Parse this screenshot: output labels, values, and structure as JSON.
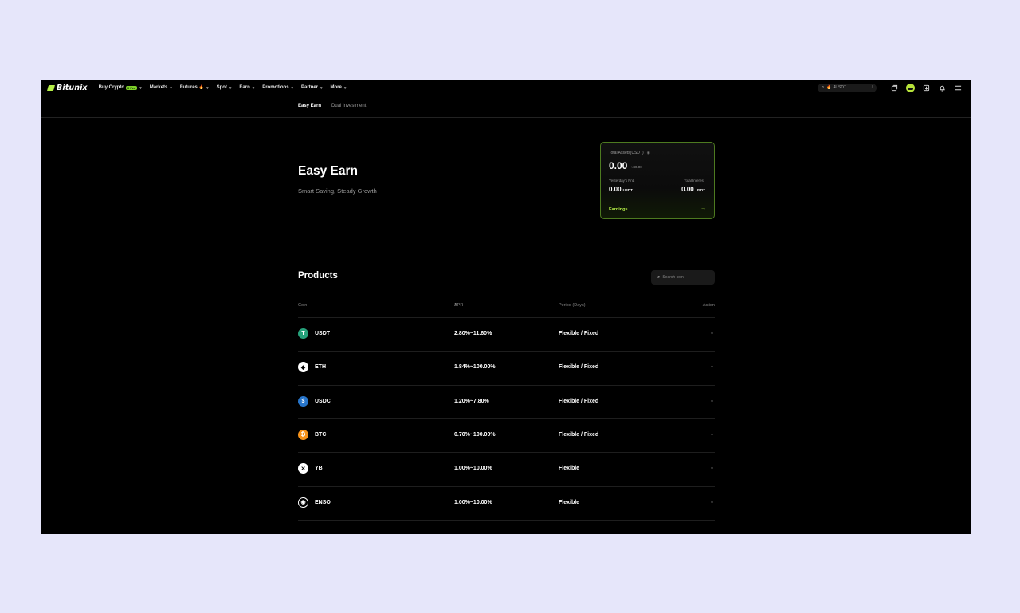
{
  "brand": {
    "name": "Bitunix"
  },
  "nav": {
    "items": [
      {
        "label": "Buy Crypto",
        "badge": "0 Fee"
      },
      {
        "label": "Markets"
      },
      {
        "label": "Futures",
        "flame": "🔥"
      },
      {
        "label": "Spot"
      },
      {
        "label": "Earn"
      },
      {
        "label": "Promotions"
      },
      {
        "label": "Partner"
      },
      {
        "label": "More"
      }
    ],
    "search_text": "4USDT",
    "search_flame": "🔥",
    "search_slash": "/"
  },
  "tabs": [
    {
      "label": "Easy Earn",
      "active": true
    },
    {
      "label": "Dual Investment",
      "active": false
    }
  ],
  "hero": {
    "title": "Easy Earn",
    "subtitle": "Smart Saving, Steady Growth"
  },
  "assets": {
    "label": "Total Assets(USDT)",
    "total": "0.00",
    "approx": "≈$0.00",
    "yesterday_label": "Yesterday's PnL",
    "yesterday_value": "0.00",
    "yesterday_unit": "USDT",
    "interest_label": "Total Interest",
    "interest_value": "0.00",
    "interest_unit": "USDT",
    "earnings_label": "Earnings",
    "accent": "#b6f047"
  },
  "products": {
    "title": "Products",
    "search_placeholder": "Search coin",
    "headers": {
      "coin": "Coin",
      "apr": "APR",
      "period": "Period (Days)",
      "action": "Action"
    },
    "rows": [
      {
        "coin": "USDT",
        "apr": "2.80%~11.60%",
        "period": "Flexible / Fixed",
        "icon_glyph": "T",
        "icon_color": "#26a17b"
      },
      {
        "coin": "ETH",
        "apr": "1.84%~100.00%",
        "period": "Flexible / Fixed",
        "icon_glyph": "◆",
        "icon_color": "#ffffff"
      },
      {
        "coin": "USDC",
        "apr": "1.20%~7.80%",
        "period": "Flexible / Fixed",
        "icon_glyph": "$",
        "icon_color": "#2775ca"
      },
      {
        "coin": "BTC",
        "apr": "0.70%~100.00%",
        "period": "Flexible / Fixed",
        "icon_glyph": "₿",
        "icon_color": "#f7931a"
      },
      {
        "coin": "YB",
        "apr": "1.00%~10.00%",
        "period": "Flexible",
        "icon_glyph": "✕",
        "icon_color": "#ffffff"
      },
      {
        "coin": "ENSO",
        "apr": "1.00%~10.00%",
        "period": "Flexible",
        "icon_glyph": "◉",
        "icon_color": "#000000"
      }
    ]
  }
}
